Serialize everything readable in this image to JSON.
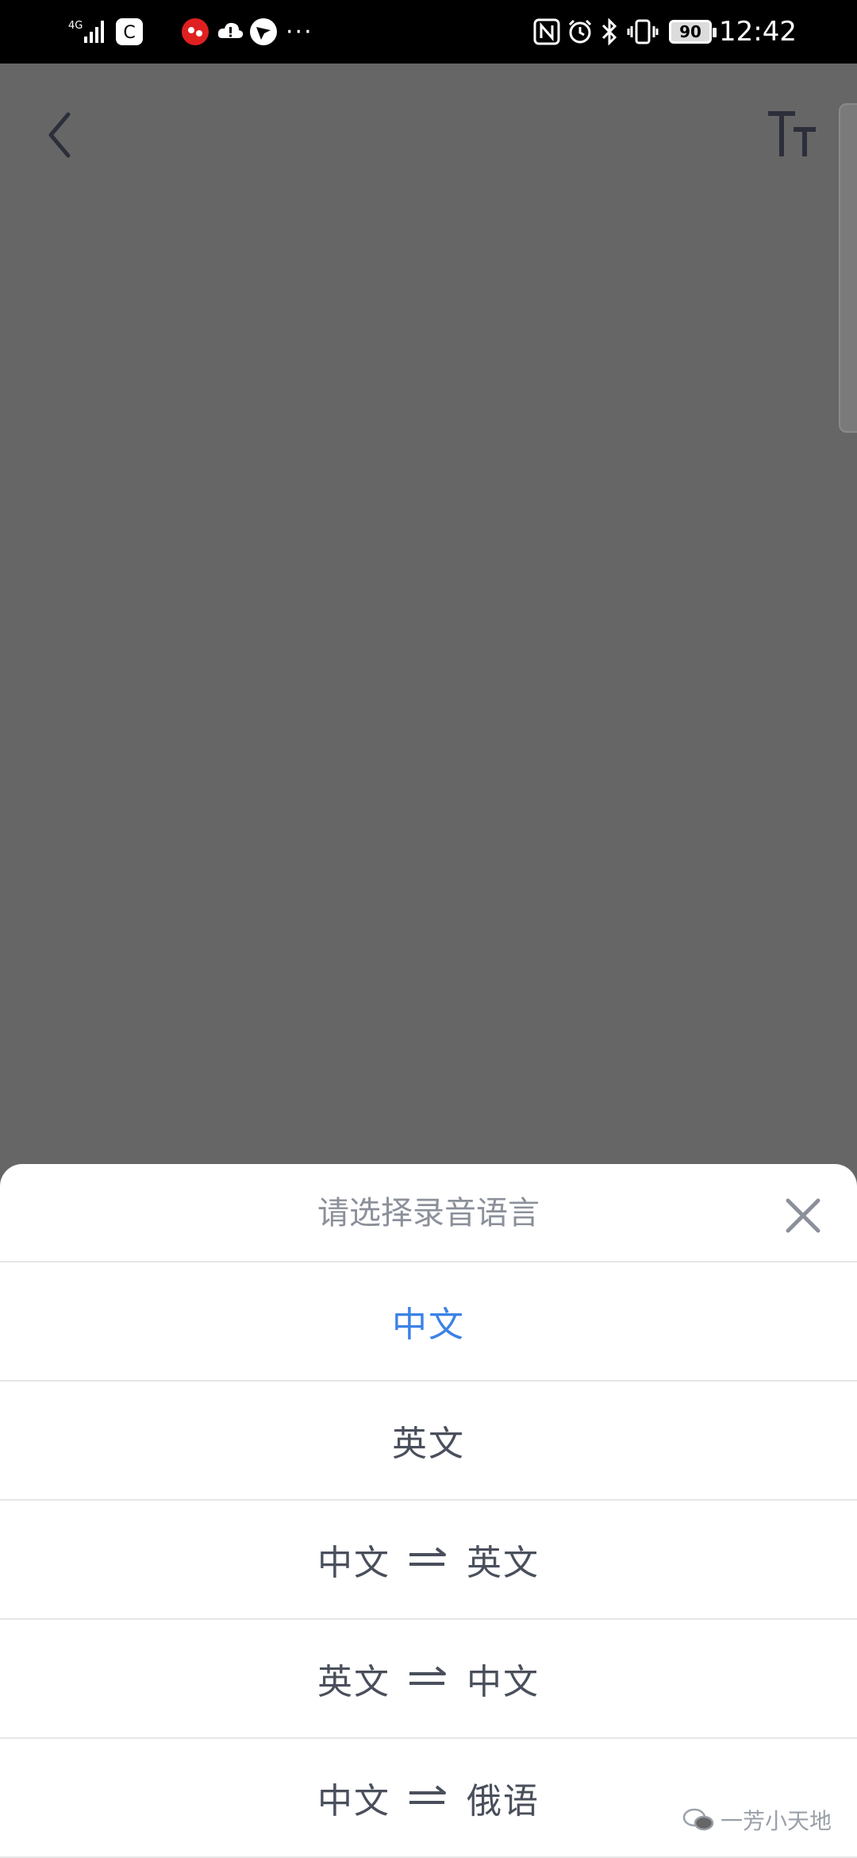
{
  "status_bar": {
    "network": "4G",
    "battery": "90",
    "time": "12:42",
    "icons": [
      "signal-icon",
      "app-c-icon",
      "notification-red-icon",
      "cloud-alert-icon",
      "bird-icon",
      "more-dots-icon",
      "nfc-icon",
      "alarm-icon",
      "bluetooth-icon",
      "vibrate-icon",
      "battery-icon"
    ]
  },
  "top_bar": {
    "back_icon": "chevron-left-icon",
    "font_size_icon": "text-size-icon"
  },
  "sheet": {
    "title": "请选择录音语言",
    "close_icon": "close-icon",
    "options": [
      {
        "from": "中文",
        "to": "",
        "selected": true
      },
      {
        "from": "英文",
        "to": "",
        "selected": false
      },
      {
        "from": "中文",
        "to": "英文",
        "selected": false
      },
      {
        "from": "英文",
        "to": "中文",
        "selected": false
      },
      {
        "from": "中文",
        "to": "俄语",
        "selected": false
      }
    ]
  },
  "watermark": {
    "text": "一芳小天地"
  },
  "colors": {
    "accent": "#3b82e6",
    "overlay": "#666666",
    "text": "#4a4f5c",
    "title": "#8b909a"
  }
}
